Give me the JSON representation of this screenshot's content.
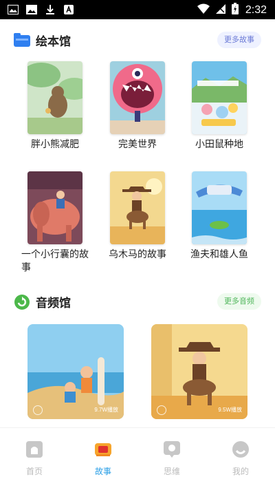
{
  "status_bar": {
    "time": "2:32"
  },
  "picture_books": {
    "title": "绘本馆",
    "more_label": "更多故事",
    "books": [
      {
        "title": "胖小熊减肥"
      },
      {
        "title": "完美世界"
      },
      {
        "title": "小田鼠种地"
      },
      {
        "title": "一个小行囊的故事"
      },
      {
        "title": "乌木马的故事"
      },
      {
        "title": "渔夫和雄人鱼"
      }
    ]
  },
  "audio": {
    "title": "音频馆",
    "more_label": "更多音频",
    "items": [
      {
        "count": "9.7W播放"
      },
      {
        "count": "9.5W播放"
      }
    ]
  },
  "bottom_nav": {
    "items": [
      {
        "label": "首页"
      },
      {
        "label": "故事"
      },
      {
        "label": "思维"
      },
      {
        "label": "我的"
      }
    ]
  },
  "colors": {
    "accent": "#2b9fe6",
    "inactive": "#bbbbbb"
  }
}
